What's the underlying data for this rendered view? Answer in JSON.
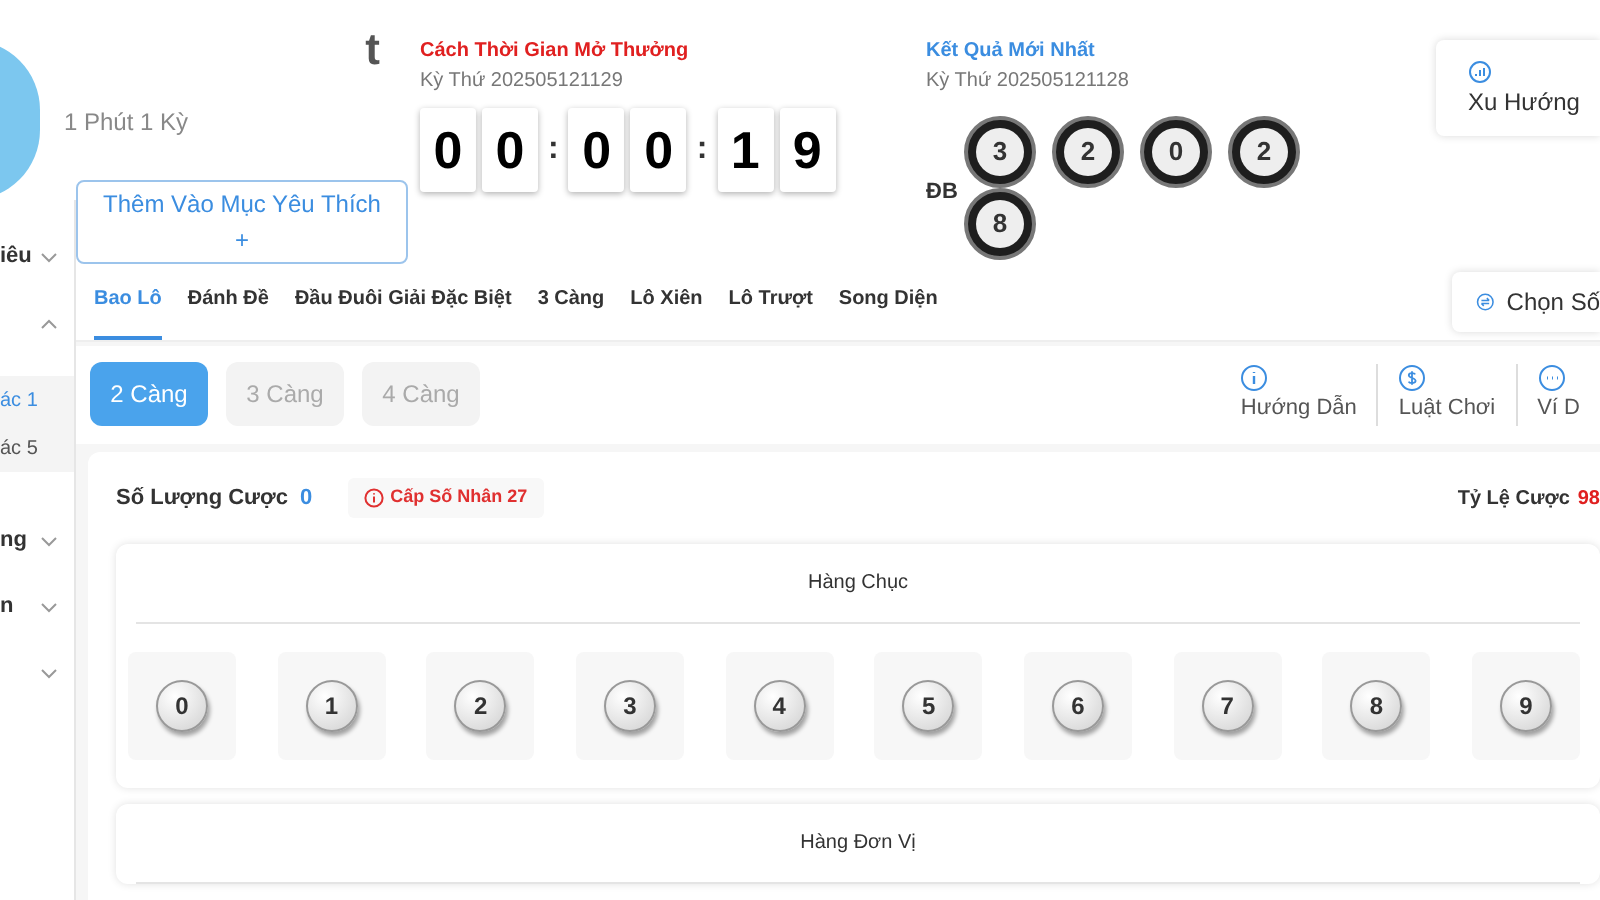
{
  "sidebar": {
    "items": [
      {
        "text": "iêu",
        "kind": "group",
        "expanded": false
      },
      {
        "kind": "group",
        "expanded": true
      },
      {
        "text": "ác 1",
        "kind": "sub",
        "selected": true
      },
      {
        "text": "ác 5",
        "kind": "sub",
        "selected": false
      },
      {
        "text": "ng",
        "kind": "group",
        "expanded": false
      },
      {
        "text": "n",
        "kind": "group",
        "expanded": false
      },
      {
        "kind": "group",
        "expanded": false
      }
    ]
  },
  "game": {
    "title_fragment": "t",
    "period": "1 Phút 1 Kỳ",
    "favorite_button": "Thêm Vào Mục Yêu Thích",
    "favorite_plus": "+"
  },
  "countdown": {
    "title": "Cách Thời Gian Mở Thưởng",
    "draw_no": "Kỳ Thứ 202505121129",
    "cells": [
      {
        "kind": "digit",
        "text": "0"
      },
      {
        "kind": "digit",
        "text": "0"
      },
      {
        "kind": "sep",
        "text": ":"
      },
      {
        "kind": "digit",
        "text": "0"
      },
      {
        "kind": "digit",
        "text": "0"
      },
      {
        "kind": "sep",
        "text": ":"
      },
      {
        "kind": "digit",
        "text": "1"
      },
      {
        "kind": "digit",
        "text": "9"
      }
    ]
  },
  "latest": {
    "title": "Kết Quả Mới Nhất",
    "draw_no": "Kỳ Thứ 202505121128",
    "label": "ĐB",
    "balls": [
      "3",
      "2",
      "0",
      "2",
      "8"
    ]
  },
  "trend_button": "Xu Hướng",
  "tabs": [
    {
      "label": "Bao Lô",
      "selected": true
    },
    {
      "label": "Đánh Đề",
      "selected": false
    },
    {
      "label": "Đầu Đuôi Giải Đặc Biệt",
      "selected": false
    },
    {
      "label": "3 Càng",
      "selected": false
    },
    {
      "label": "Lô Xiên",
      "selected": false
    },
    {
      "label": "Lô Trượt",
      "selected": false
    },
    {
      "label": "Song Diện",
      "selected": false
    }
  ],
  "pick_button": "Chọn Số",
  "modes": [
    {
      "label": "2 Càng",
      "selected": true
    },
    {
      "label": "3 Càng",
      "selected": false
    },
    {
      "label": "4 Càng",
      "selected": false
    }
  ],
  "actions": [
    {
      "kind": "info",
      "label": "Hướng Dẫn"
    },
    {
      "kind": "dollar",
      "label": "Luật Chơi"
    },
    {
      "kind": "more",
      "label": "Ví D"
    }
  ],
  "bet": {
    "count_label": "Số Lượng Cược",
    "count": "0",
    "multiplier": "Cấp Số Nhân 27",
    "odds_label": "Tỷ Lệ Cược",
    "odds": "98"
  },
  "sections": [
    {
      "title": "Hàng Chục",
      "numbers": [
        "0",
        "1",
        "2",
        "3",
        "4",
        "5",
        "6",
        "7",
        "8",
        "9"
      ]
    },
    {
      "title": "Hàng Đơn Vị"
    }
  ]
}
